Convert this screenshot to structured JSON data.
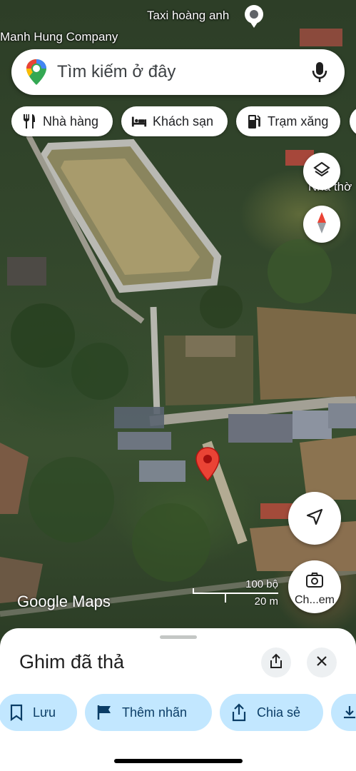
{
  "map": {
    "labels": {
      "top_place": "Taxi hoàng anh",
      "left_place": "Manh Hung Company",
      "right_place": "Nhà thờ"
    },
    "watermark": "Google Maps",
    "scale": {
      "imperial": "100 bộ",
      "metric": "20 m"
    },
    "street_view_label": "Ch...em"
  },
  "search": {
    "placeholder": "Tìm kiếm ở đây"
  },
  "chips": [
    {
      "label": "Nhà hàng",
      "icon": "restaurant-icon"
    },
    {
      "label": "Khách sạn",
      "icon": "hotel-icon"
    },
    {
      "label": "Trạm xăng",
      "icon": "gas-station-icon"
    }
  ],
  "sheet": {
    "title": "Ghim đã thả",
    "actions": [
      {
        "label": "Lưu",
        "icon": "bookmark-icon"
      },
      {
        "label": "Thêm nhãn",
        "icon": "flag-icon"
      },
      {
        "label": "Chia sẻ",
        "icon": "share-icon"
      }
    ]
  },
  "colors": {
    "pin": "#ea4335",
    "action_bg": "#c2e7ff",
    "action_text": "#0b3d66"
  }
}
